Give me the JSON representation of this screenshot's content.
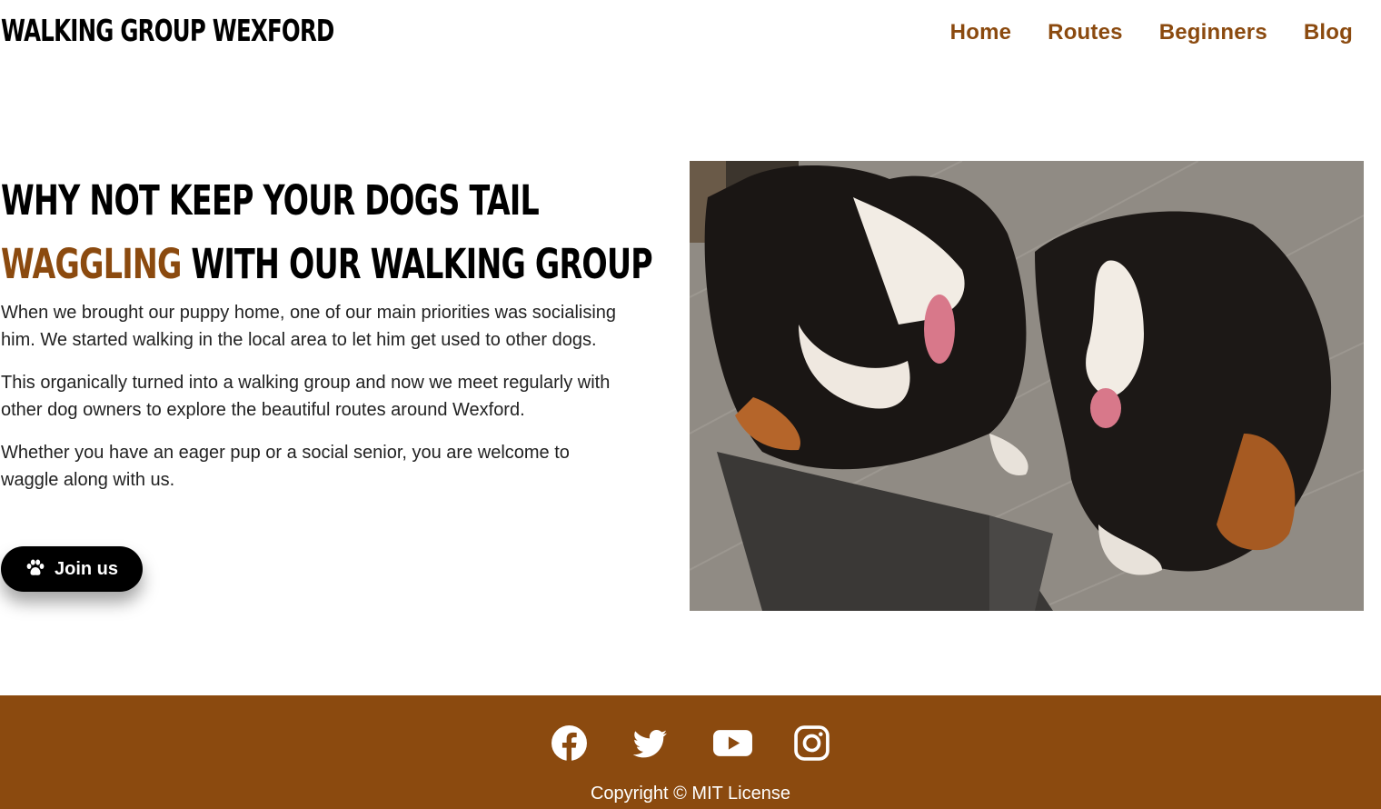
{
  "brand": {
    "title": "WALKING GROUP WEXFORD"
  },
  "nav": {
    "items": [
      {
        "label": "Home"
      },
      {
        "label": "Routes"
      },
      {
        "label": "Beginners"
      },
      {
        "label": "Blog"
      }
    ]
  },
  "hero": {
    "headline_line1": "WHY NOT KEEP YOUR DOGS TAIL",
    "headline_accent": "WAGGLING",
    "headline_line2_rest": " WITH OUR WALKING GROUP",
    "paragraphs": [
      "When we brought our puppy home, one of our main priorities was socialising him. We started walking in the local area to let him get used to other dogs.",
      "This organically turned into a walking group and now we meet regularly with other dog owners to explore the beautiful routes around Wexford.",
      "Whether you have an eager pup or a social senior, you are welcome to waggle along with us."
    ],
    "join_button": {
      "label": "Join us",
      "icon": "paw-icon"
    },
    "image": {
      "subject": "two Bernese mountain dogs lying on a wooden floor beside a laptop"
    }
  },
  "footer": {
    "socials": [
      {
        "icon": "facebook-icon"
      },
      {
        "icon": "twitter-icon"
      },
      {
        "icon": "youtube-icon"
      },
      {
        "icon": "instagram-icon"
      }
    ],
    "copyright": "Copyright © MIT License"
  },
  "colors": {
    "accent": "#8b4a0f",
    "footer_bg": "#8b4a0f",
    "button_bg": "#000000",
    "text": "#222222"
  }
}
